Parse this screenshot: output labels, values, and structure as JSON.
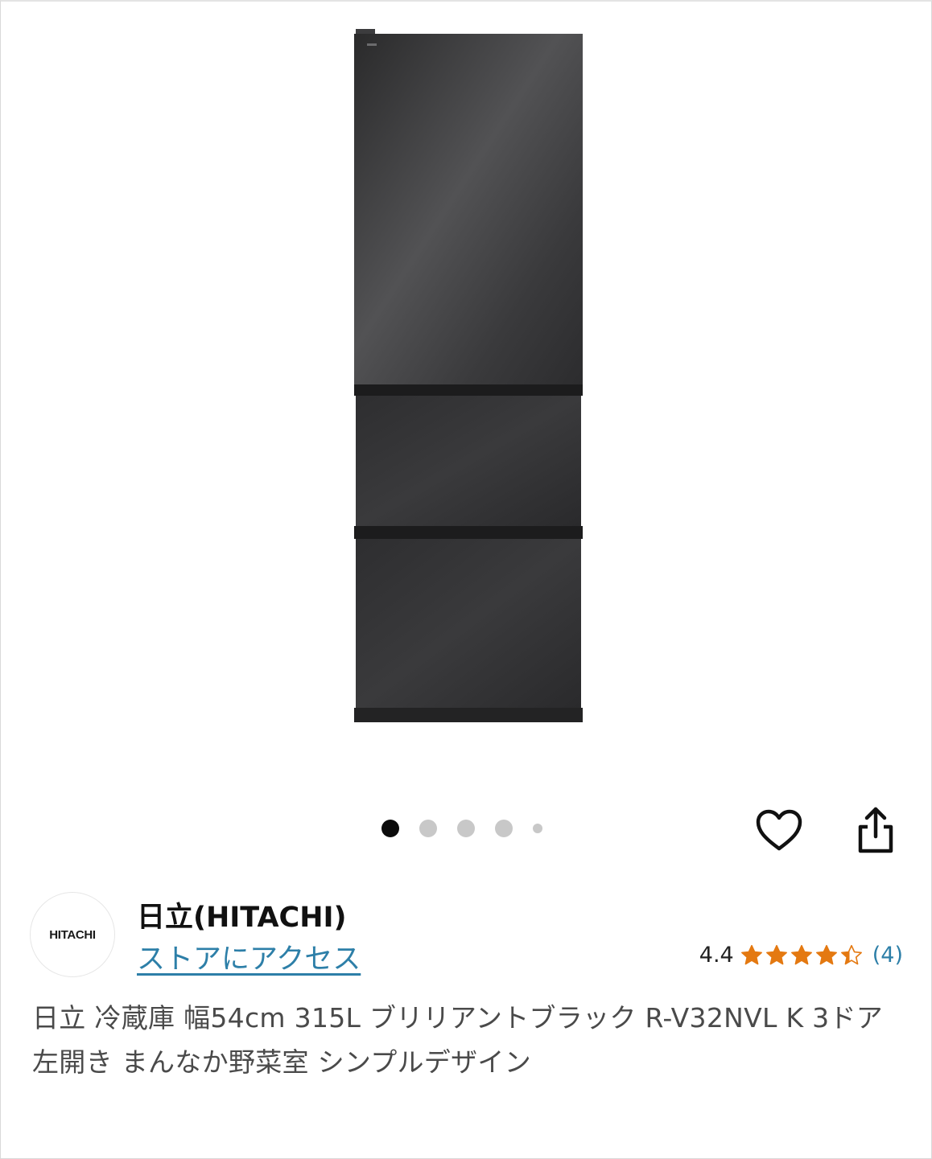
{
  "product": {
    "image_alt": "refrigerator",
    "carousel": {
      "total": 5,
      "active_index": 0
    }
  },
  "actions": {
    "favorite_icon": "heart-icon",
    "share_icon": "share-icon"
  },
  "brand": {
    "logo_text": "HITACHI",
    "name": "日立(HITACHI)",
    "store_link": "ストアにアクセス"
  },
  "rating": {
    "score": "4.4",
    "value": 4.4,
    "max": 5,
    "count": "(4)",
    "star_color": "#e47911"
  },
  "title": "日立 冷蔵庫 幅54cm 315L ブリリアントブラック R-V32NVL K 3ドア 左開き まんなか野菜室 シンプルデザイン",
  "colors": {
    "link": "#2d7fa8",
    "dot_active": "#0b0b0b",
    "dot_inactive": "#c8c8c8"
  }
}
